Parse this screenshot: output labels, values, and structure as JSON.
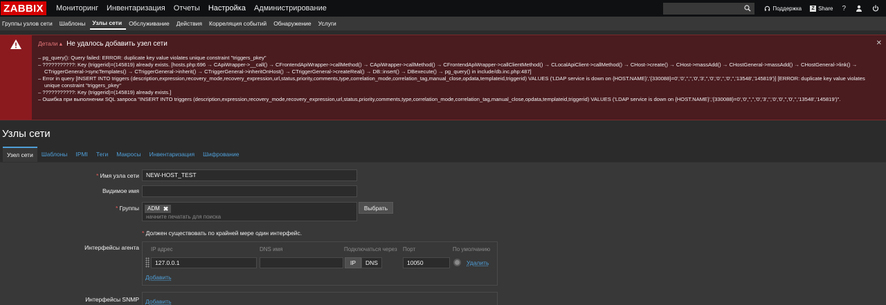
{
  "brand": {
    "logo": "ZABBIX"
  },
  "topnav": {
    "items": [
      "Мониторинг",
      "Инвентаризация",
      "Отчеты",
      "Настройка",
      "Администрирование"
    ],
    "active": "Настройка",
    "support_label": "Поддержка",
    "share_label": "Share",
    "help_label": "?",
    "share_icon_glyph": "Z"
  },
  "subnav": {
    "items": [
      "Группы узлов сети",
      "Шаблоны",
      "Узлы сети",
      "Обслуживание",
      "Действия",
      "Корреляция событий",
      "Обнаружение",
      "Услуги"
    ],
    "active": "Узлы сети"
  },
  "error": {
    "details_label": "Детали ▴",
    "title": "Не удалось добавить узел сети",
    "lines": [
      "pg_query(): Query failed: ERROR: duplicate key value violates unique constraint \"triggers_pkey\"",
      "???????????: Key (triggerid)=(145819) already exists. [hosts.php:696 → CApiWrapper->__call() → CFrontendApiWrapper->callMethod() → CApiWrapper->callMethod() → CFrontendApiWrapper->callClientMethod() → CLocalApiClient->callMethod() → CHost->create() → CHost->massAdd() → CHostGeneral->massAdd() → CHostGeneral->link() → CTriggerGeneral->syncTemplates() → CTriggerGeneral->inherit() → CTriggerGeneral->inheritOnHost() → CTriggerGeneral->createReal() → DB::insert() → DBexecute() → pg_query() in include/db.inc.php:487]",
      "Error in query [INSERT INTO triggers (description,expression,recovery_mode,recovery_expression,url,status,priority,comments,type,correlation_mode,correlation_tag,manual_close,opdata,templateid,triggerid) VALUES ('LDAP service is down on {HOST.NAME}','{330088}=0','0','','','0','3','','0','0','','0','','13548','145819')] [ERROR: duplicate key value violates unique constraint \"triggers_pkey\"",
      "???????????: Key (triggerid)=(145819) already exists.]",
      "Ошибка при выполнении SQL запроса \"INSERT INTO triggers (description,expression,recovery_mode,recovery_expression,url,status,priority,comments,type,correlation_mode,correlation_tag,manual_close,opdata,templateid,triggerid) VALUES ('LDAP service is down on {HOST.NAME}','{330088}=0','0','','','0','3','','0','0','','0','','13548','145819')\"."
    ],
    "close_glyph": "✕"
  },
  "page": {
    "title": "Узлы сети"
  },
  "form": {
    "tabs": [
      "Узел сети",
      "Шаблоны",
      "IPMI",
      "Теги",
      "Макросы",
      "Инвентаризация",
      "Шифрование"
    ],
    "active_tab": "Узел сети",
    "host_name_label": "Имя узла сети",
    "host_name_value": "NEW-HOST_TEST",
    "visible_name_label": "Видимое имя",
    "visible_name_value": "",
    "groups_label": "Группы",
    "group_tag": "ADM",
    "group_tag_remove": "✖",
    "groups_placeholder": "начните печатать для поиска",
    "select_button": "Выбрать",
    "interface_note": "Должен существовать по крайней мере один интерфейс.",
    "agent_interfaces_label": "Интерфейсы агента",
    "iface_headers": {
      "ip": "IP адрес",
      "dns": "DNS имя",
      "connect": "Подключаться через",
      "port": "Порт",
      "default": "По умолчанию"
    },
    "iface": {
      "ip": "127.0.0.1",
      "dns": "",
      "ip_btn": "IP",
      "dns_btn": "DNS",
      "port": "10050",
      "remove": "Удалить"
    },
    "add_link": "Добавить",
    "snmp_label": "Интерфейсы SNMP",
    "snmp_add": "Добавить"
  },
  "colors": {
    "accent": "#4f9fd8",
    "error_bg": "#4a1b1f",
    "error_side": "#8b1a1f",
    "brand": "#d40000"
  }
}
